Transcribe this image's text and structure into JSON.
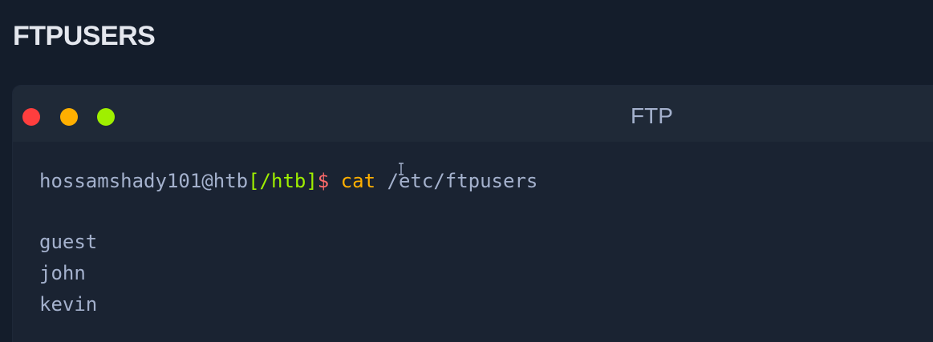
{
  "page": {
    "title": "FTPUSERS"
  },
  "terminal": {
    "title": "FTP",
    "prompt": {
      "user_host": "hossamshady101@htb",
      "dir": "[/htb]",
      "symbol": "$",
      "command": "cat",
      "args": "/etc/ftpusers"
    },
    "output": [
      "guest",
      "john",
      "kevin"
    ],
    "window_buttons": {
      "close_color": "#ff3e3e",
      "minimize_color": "#ffaf00",
      "maximize_color": "#9fef00"
    }
  },
  "colors": {
    "background": "#141d2b",
    "terminal_body": "#1a2332",
    "terminal_titlebar": "#1f2937",
    "text": "#a4b1cd",
    "accent_green": "#9fef00",
    "accent_orange": "#ffaf00",
    "accent_red": "#ff6a6a"
  },
  "icons": {
    "cursor": "text-cursor-icon"
  }
}
